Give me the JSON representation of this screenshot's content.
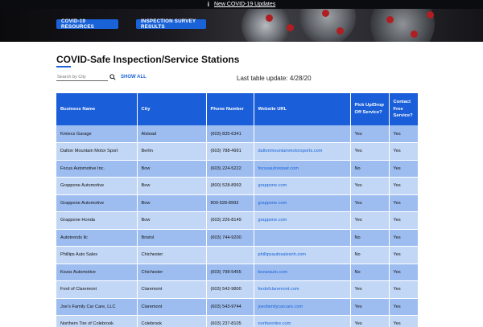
{
  "notice": {
    "text": "New COVID-19 Updates",
    "icon": "info-icon"
  },
  "nav": {
    "resources_label": "COVID-19 RESOURCES",
    "survey_label": "INSPECTION SURVEY RESULTS"
  },
  "title": "COVID-Safe Inspection/Service Stations",
  "search": {
    "placeholder": "Search by City",
    "value": ""
  },
  "show_all_label": "SHOW ALL",
  "last_update": "Last table update: 4/28/20",
  "table": {
    "headers": [
      "Business Name",
      "City",
      "Phone Number",
      "Website URL",
      "Pick Up/Drop Off Service?",
      "Contact Free Service?"
    ],
    "rows": [
      [
        "Kmiecs Garage",
        "Alstead",
        "(603) 835-6341",
        "",
        "Yes",
        "Yes"
      ],
      [
        "Dalton Mountain Motor Sport",
        "Berlin",
        "(603) 788-4991",
        "daltonmountainmotorsports.com",
        "Yes",
        "Yes"
      ],
      [
        "Focus Automotive Inc.",
        "Bow",
        "(603) 224-5222",
        "focusautorepair.com",
        "No",
        "Yes"
      ],
      [
        "Grappone Automotive",
        "Bow",
        "(800) 528-8993",
        "grappone.com",
        "Yes",
        "Yes"
      ],
      [
        "Grappone Automotive",
        "Bow",
        "800-528-8993",
        "grappone.com",
        "Yes",
        "Yes"
      ],
      [
        "Grappone Honda",
        "Bow",
        "(603) 226-8149",
        "grappone.com",
        "Yes",
        "Yes"
      ],
      [
        "Autotrends llc",
        "Bristol",
        "(603) 744-9200",
        "",
        "No",
        "Yes"
      ],
      [
        "Phillips Auto Sales",
        "Chichester",
        "",
        "phillipsautosalesnh.com",
        "No",
        "Yes"
      ],
      [
        "Kezar Automotive",
        "Chichester",
        "(603) 798-5455",
        "kezarauto.com",
        "No",
        "Yes"
      ],
      [
        "Ford of Claremont",
        "Claremont",
        "(603) 542-9800",
        "fordofclaremont.com",
        "Yes",
        "Yes"
      ],
      [
        "Joe's Family Car Care, LLC",
        "Claremont",
        "(603) 543-9744",
        "joesfamilycarcare.com",
        "Yes",
        "Yes"
      ],
      [
        "Northern Tire of Colebrook",
        "Colebrook",
        "(603) 237-8105",
        "northerntire.com",
        "Yes",
        "Yes"
      ]
    ]
  }
}
